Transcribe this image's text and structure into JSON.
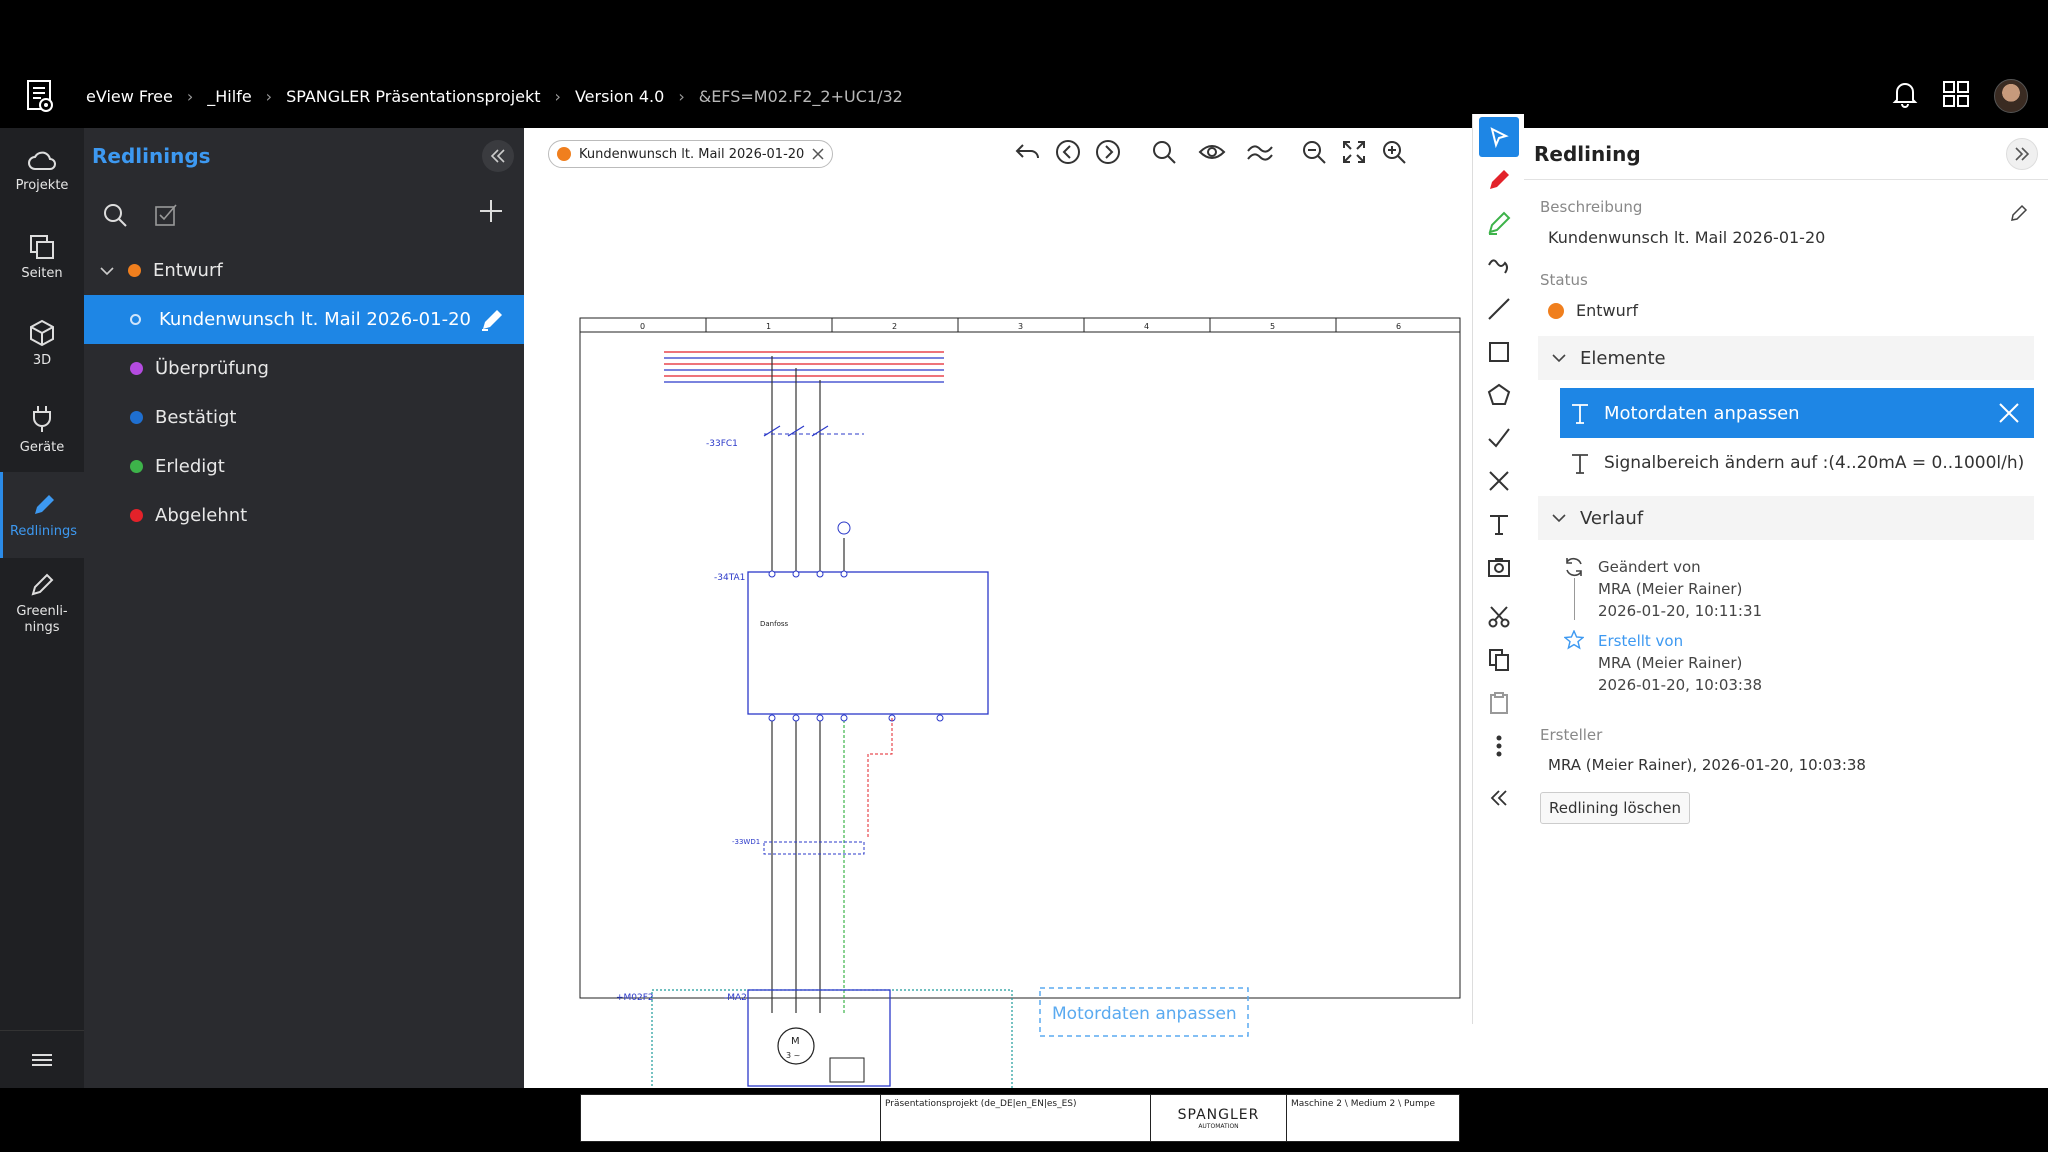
{
  "topbar": {
    "breadcrumb": [
      "eView Free",
      "_Hilfe",
      "SPANGLER Präsentationsprojekt",
      "Version 4.0",
      "&EFS=M02.F2_2+UC1/32"
    ]
  },
  "nav": {
    "items": [
      {
        "label": "Projekte",
        "icon": "cloud-icon"
      },
      {
        "label": "Seiten",
        "icon": "pages-icon"
      },
      {
        "label": "3D",
        "icon": "cube-icon"
      },
      {
        "label": "Geräte",
        "icon": "plug-icon"
      },
      {
        "label": "Redlinings",
        "icon": "pen-icon",
        "active": true
      },
      {
        "label": "Greenli-\nnings",
        "icon": "pen-outline-icon"
      }
    ]
  },
  "redlinings": {
    "title": "Redlinings",
    "groups": [
      {
        "label": "Entwurf",
        "color": "#f07f1e"
      },
      {
        "label": "Kundenwunsch lt. Mail 2026-01-20"
      },
      {
        "label": "Überprüfung",
        "color": "#b44be0"
      },
      {
        "label": "Bestätigt",
        "color": "#1f6fd0"
      },
      {
        "label": "Erledigt",
        "color": "#3db34a"
      },
      {
        "label": "Abgelehnt",
        "color": "#e3222a"
      }
    ]
  },
  "canvas": {
    "chip_label": "Kundenwunsch lt. Mail 2026-01-20",
    "chip_color": "#f07f1e",
    "annotation": "Motordaten anpassen",
    "columns": [
      "0",
      "1",
      "2",
      "3",
      "4",
      "5",
      "6"
    ],
    "device_labels": {
      "fc": "-33FC1",
      "ta": "-34TA1",
      "wd": "-33WD1",
      "ma": "-MA2",
      "loc": "+M02F2",
      "danfoss": "Danfoss",
      "motor": "M",
      "motor_phase": "3 ~"
    },
    "title_block": {
      "project": "Präsentationsprojekt (de_DE|en_EN|es_ES)",
      "location": "Maschine 2 \\ Medium 2 \\ Pumpe",
      "brand": "SPANGLER",
      "brand_sub": "AUTOMATION"
    }
  },
  "props": {
    "title": "Redlining",
    "beschreibung_label": "Beschreibung",
    "beschreibung": "Kundenwunsch lt. Mail 2026-01-20",
    "status_label": "Status",
    "status": "Entwurf",
    "status_color": "#f07f1e",
    "elemente_label": "Elemente",
    "elemente": [
      "Motordaten anpassen",
      "Signalbereich ändern auf :(4..20mA = 0..1000l/h)"
    ],
    "verlauf_label": "Verlauf",
    "verlauf": [
      {
        "title": "Geändert von",
        "user": "MRA (Meier Rainer)",
        "time": "2026-01-20, 10:11:31"
      },
      {
        "title": "Erstellt von",
        "user": "MRA (Meier Rainer)",
        "time": "2026-01-20, 10:03:38"
      }
    ],
    "ersteller_label": "Ersteller",
    "ersteller": "MRA (Meier Rainer), 2026-01-20, 10:03:38",
    "delete_label": "Redlining löschen"
  },
  "colors": {
    "accent": "#1e86e5",
    "accent_text": "#3d99f1"
  }
}
